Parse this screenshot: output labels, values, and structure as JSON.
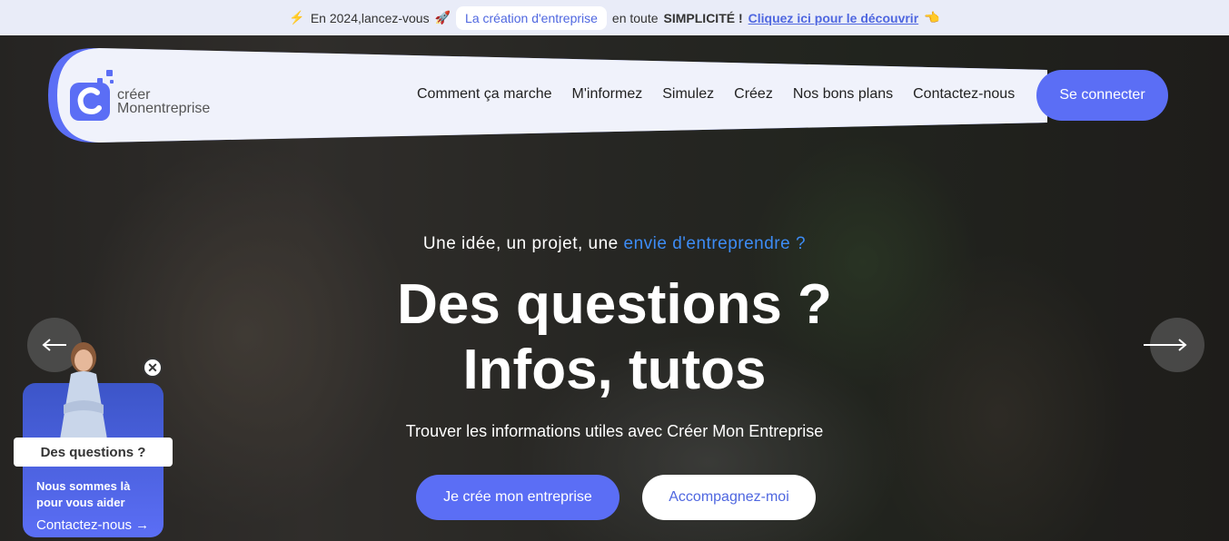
{
  "announcement": {
    "prefix": "En 2024,lancez-vous",
    "pill": "La création d'entreprise",
    "middle": "en toute",
    "emphasis": "SIMPLICITÉ !",
    "link": "Cliquez ici pour le découvrir",
    "icons": [
      "bolt-icon",
      "rocket-icon",
      "pointing-hand-icon"
    ]
  },
  "logo": {
    "line1": "créer",
    "line2": "Monentreprise"
  },
  "nav": {
    "items": [
      "Comment ça marche",
      "M'informez",
      "Simulez",
      "Créez",
      "Nos bons plans",
      "Contactez-nous"
    ],
    "connect": "Se connecter"
  },
  "hero": {
    "tagline_start": "Une idée, un projet, une ",
    "tagline_highlight": "envie d'entreprendre ?",
    "headline_1": "Des questions ?",
    "headline_2": "Infos, tutos",
    "subtitle": "Trouver les informations utiles avec Créer Mon Entreprise",
    "cta_primary": "Je crée mon entreprise",
    "cta_secondary": "Accompagnez-moi"
  },
  "chat": {
    "question": "Des questions ?",
    "help": "Nous sommes là pour vous aider",
    "contact": "Contactez-nous"
  },
  "colors": {
    "accent": "#5b6ef5",
    "highlight": "#3d8cf5",
    "band": "#f0f2fb"
  }
}
